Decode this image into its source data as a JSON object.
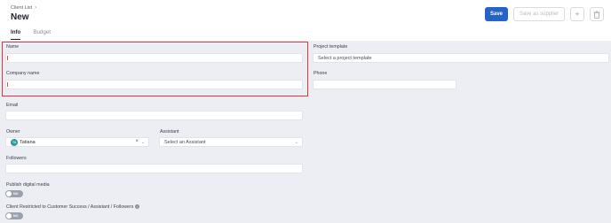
{
  "header": {
    "breadcrumb": "Client List",
    "title": "New",
    "tabs": [
      {
        "label": "Info",
        "active": true
      },
      {
        "label": "Budget",
        "active": false
      }
    ],
    "actions": {
      "save_label": "Save",
      "supplier_label": "Save as supplier",
      "add_icon": "plus-icon",
      "delete_icon": "trash-icon"
    }
  },
  "form": {
    "name": {
      "label": "Name",
      "value": ""
    },
    "company_name": {
      "label": "Company name",
      "value": ""
    },
    "email": {
      "label": "Email",
      "value": ""
    },
    "owner": {
      "label": "Owner",
      "avatar_initials": "TA",
      "value": "Tatiana"
    },
    "assistant": {
      "label": "Assistant",
      "placeholder": "Select an Assistant"
    },
    "followers": {
      "label": "Followers",
      "value": ""
    },
    "publish_digital_media": {
      "label": "Publish digital media",
      "toggle_text": "NO",
      "value": false
    },
    "client_restricted": {
      "label": "Client Restricted to Customer Success / Assistant / Followers",
      "toggle_text": "NO",
      "value": false
    },
    "project_template": {
      "label": "Project template",
      "placeholder": "Select a project template"
    },
    "phone": {
      "label": "Phone",
      "value": ""
    }
  },
  "colors": {
    "primary": "#2563c9",
    "highlight": "#d63a3a",
    "required_marker": "#e04c4c",
    "background": "#eceef3"
  }
}
